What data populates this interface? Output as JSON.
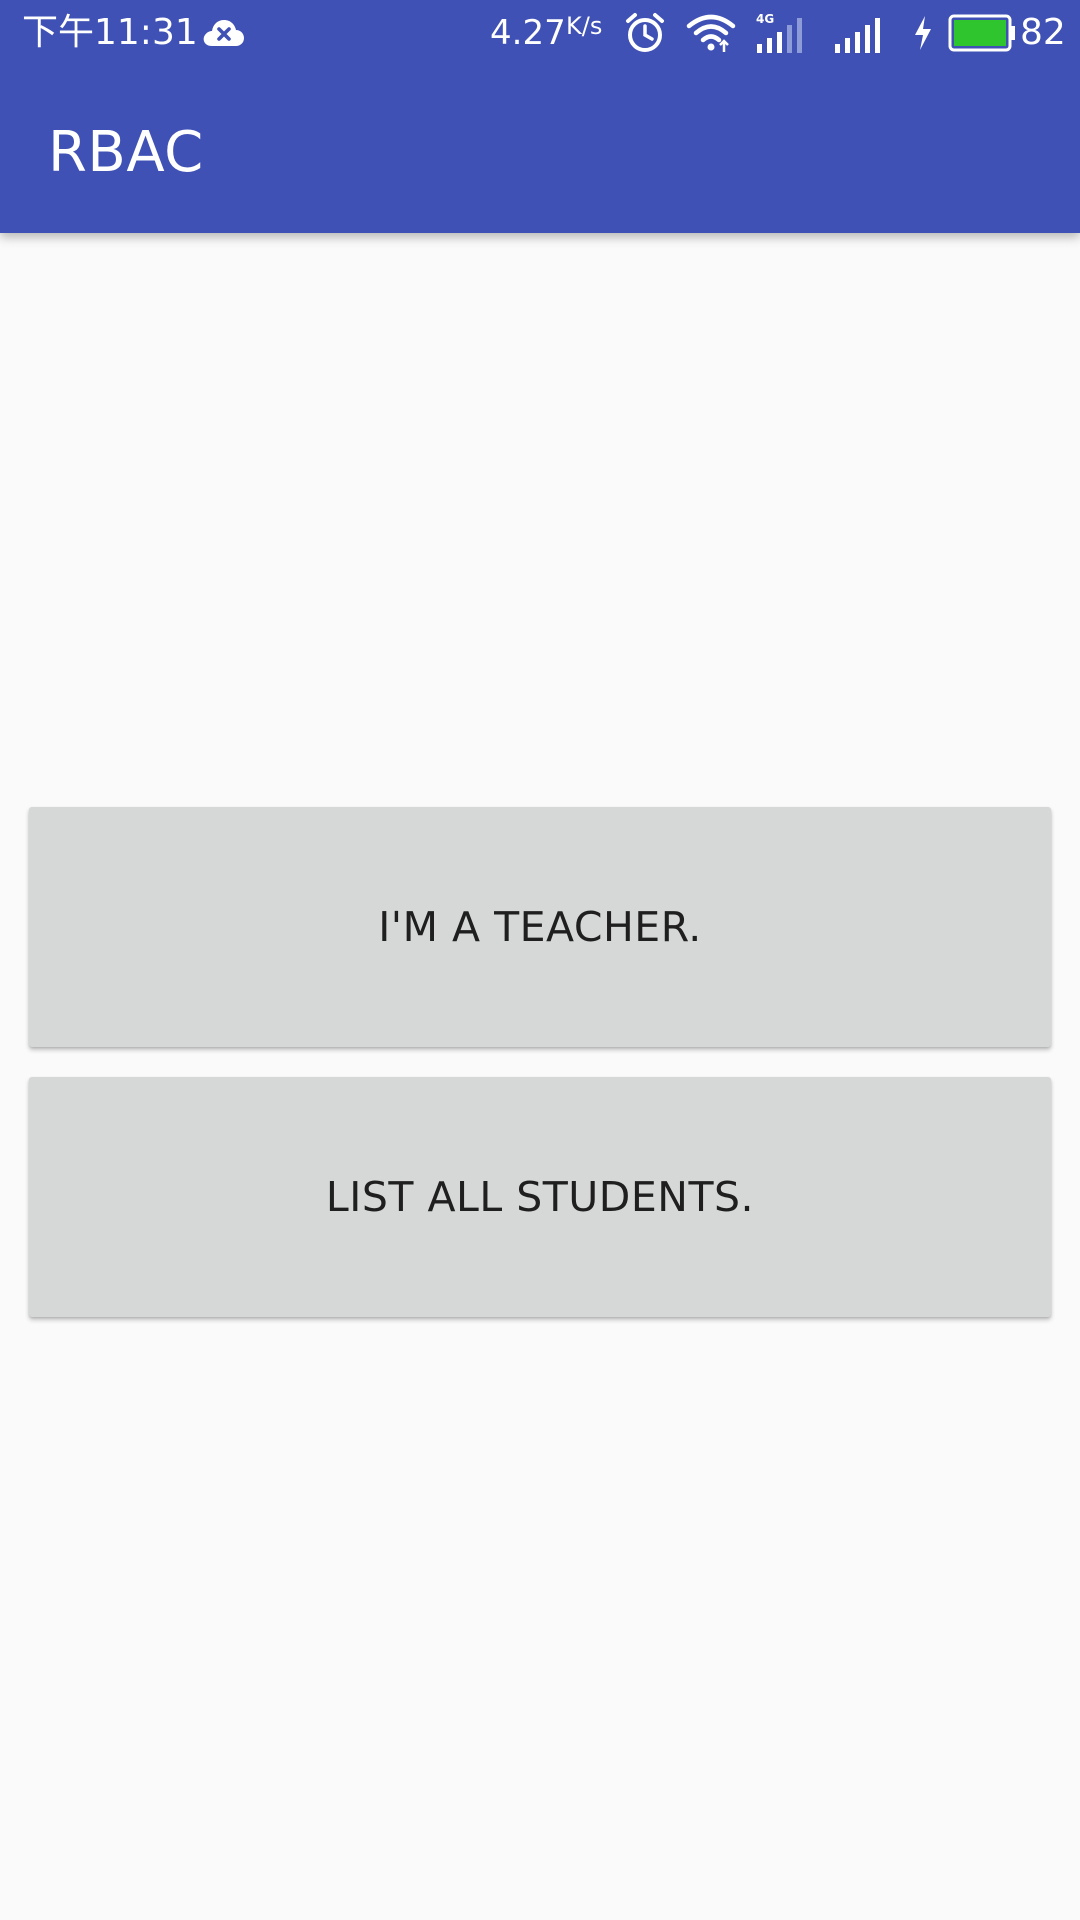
{
  "status_bar": {
    "time": "下午11:31",
    "net_speed": "4.27",
    "net_speed_unit": "K/s",
    "network_type": "4G",
    "battery_level": "82",
    "icons": [
      "cloud-error-icon",
      "alarm-icon",
      "wifi-icon",
      "signal-4g-icon",
      "signal-icon",
      "charging-icon",
      "battery-icon"
    ]
  },
  "app_bar": {
    "title": "RBAC"
  },
  "main": {
    "buttons": [
      {
        "label": "I'M A TEACHER."
      },
      {
        "label": "LIST ALL STUDENTS."
      }
    ]
  },
  "colors": {
    "primary": "#3f51b5",
    "background": "#fafafa",
    "button": "#d6d7d7",
    "battery_fill": "#2ec52e"
  }
}
